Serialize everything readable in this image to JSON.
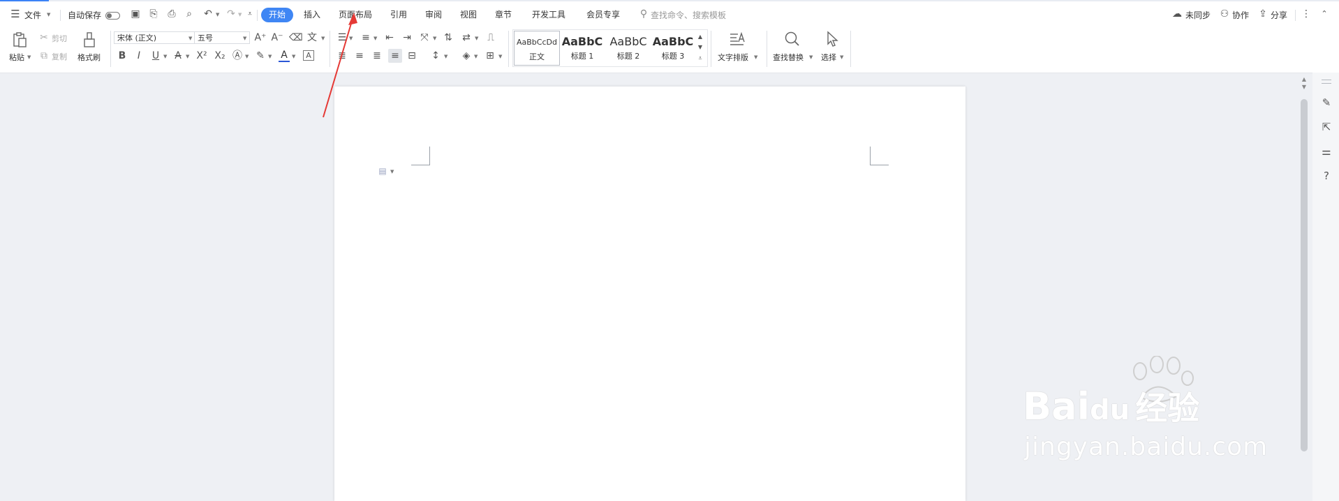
{
  "menubar": {
    "file_label": "文件",
    "autosave_label": "自动保存",
    "tabs": [
      "开始",
      "插入",
      "页面布局",
      "引用",
      "审阅",
      "视图",
      "章节",
      "开发工具",
      "会员专享"
    ],
    "search_placeholder": "查找命令、搜索模板",
    "sync_label": "未同步",
    "collab_label": "协作",
    "share_label": "分享"
  },
  "ribbon": {
    "paste_label": "粘贴",
    "cut_label": "剪切",
    "copy_label": "复制",
    "format_painter_label": "格式刷",
    "font_name": "宋体 (正文)",
    "font_size": "五号",
    "styles": [
      {
        "sample": "AaBbCcDd",
        "label": "正文"
      },
      {
        "sample": "AaBbC",
        "label": "标题 1"
      },
      {
        "sample": "AaBbC",
        "label": "标题 2"
      },
      {
        "sample": "AaBbC",
        "label": "标题 3"
      }
    ],
    "text_layout_label": "文字排版",
    "find_replace_label": "查找替换",
    "select_label": "选择"
  },
  "watermark": {
    "brand": "Bai",
    "brand_du": "du",
    "brand_cn": "经验",
    "url": "jingyan.baidu.com"
  },
  "colors": {
    "accent": "#3f86f4",
    "annotation_arrow": "#e53935"
  }
}
